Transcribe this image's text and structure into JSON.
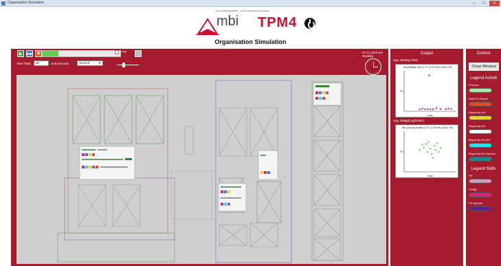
{
  "window": {
    "title": "Organisation Simulation",
    "minimize": "–",
    "maximize": "□",
    "close": "×"
  },
  "header": {
    "mbi_tagline": "Innovationsstellen - und Kompetenzzentrum",
    "mbi_text": "mbi",
    "tpm_text": "TPM4",
    "page_title": "Organisation Simulation"
  },
  "simulation": {
    "play_icon": "play-icon",
    "step_icon": "skip-icon",
    "stop_icon": "stop-icon",
    "progress_fraction": 0.2,
    "checkbox_label": "Loop",
    "time_step_label": "Time Step:",
    "time_step_value": "60",
    "unit_label": "Unit seconds",
    "unit_value": "Second",
    "date": "07.11.2016 am",
    "weekday": "Monday"
  },
  "output": {
    "title": "Output",
    "chart1_label": "Avg. Waiting Time",
    "chart1_title": "Avg Waiting Time 0_P1 12 FH 09c VA211 HH",
    "chart1_ylabel": "P/s",
    "chart1_xlabel": "Days",
    "chart2_label": "Avg. Delay(Log/Order)",
    "chart2_title": "Sth (moving month) 0_P1 12 FH 09c VA211 HH",
    "chart2_ylabel": "P/s",
    "chart2_xlabel": "Days",
    "chart1_points": [
      [
        0.3,
        0.05
      ],
      [
        0.35,
        0.07
      ],
      [
        0.4,
        0.05
      ],
      [
        0.45,
        0.06
      ],
      [
        0.55,
        0.05
      ],
      [
        0.62,
        0.08
      ],
      [
        0.7,
        0.06
      ],
      [
        0.48,
        0.9
      ],
      [
        0.5,
        0.05
      ],
      [
        0.8,
        0.05
      ],
      [
        0.85,
        0.07
      ],
      [
        0.9,
        0.06
      ]
    ],
    "chart2_points": [
      [
        0.3,
        0.55
      ],
      [
        0.38,
        0.6
      ],
      [
        0.42,
        0.7
      ],
      [
        0.45,
        0.5
      ],
      [
        0.5,
        0.58
      ],
      [
        0.53,
        0.45
      ],
      [
        0.58,
        0.65
      ],
      [
        0.6,
        0.55
      ],
      [
        0.63,
        0.72
      ],
      [
        0.66,
        0.5
      ],
      [
        0.7,
        0.6
      ],
      [
        0.55,
        0.35
      ],
      [
        0.47,
        0.75
      ],
      [
        0.35,
        0.68
      ]
    ]
  },
  "control": {
    "title": "Control",
    "close_label": "Close Window",
    "legend_activities_title": "Legend Activiti",
    "activities": [
      {
        "label": "Process",
        "color": "#a8e6a1"
      },
      {
        "label": "Wait For Repair",
        "color": "#e8462a"
      },
      {
        "label": "Repair By HH",
        "color": "#f2d21b"
      },
      {
        "label": "Repair By FH",
        "color": "#ffffff"
      },
      {
        "label": "Repair By FH-RH",
        "color": "#16e6ef"
      },
      {
        "label": "Repair By FH-Special",
        "color": "#148a8c"
      }
    ],
    "legend_skills_title": "Legend Skills",
    "skills": [
      {
        "label": "FH",
        "color": "#e58fc2"
      },
      {
        "label": "FHAtg",
        "color": "#e0217a"
      },
      {
        "label": "FH-Special",
        "color": "#6a1a8e"
      }
    ]
  }
}
